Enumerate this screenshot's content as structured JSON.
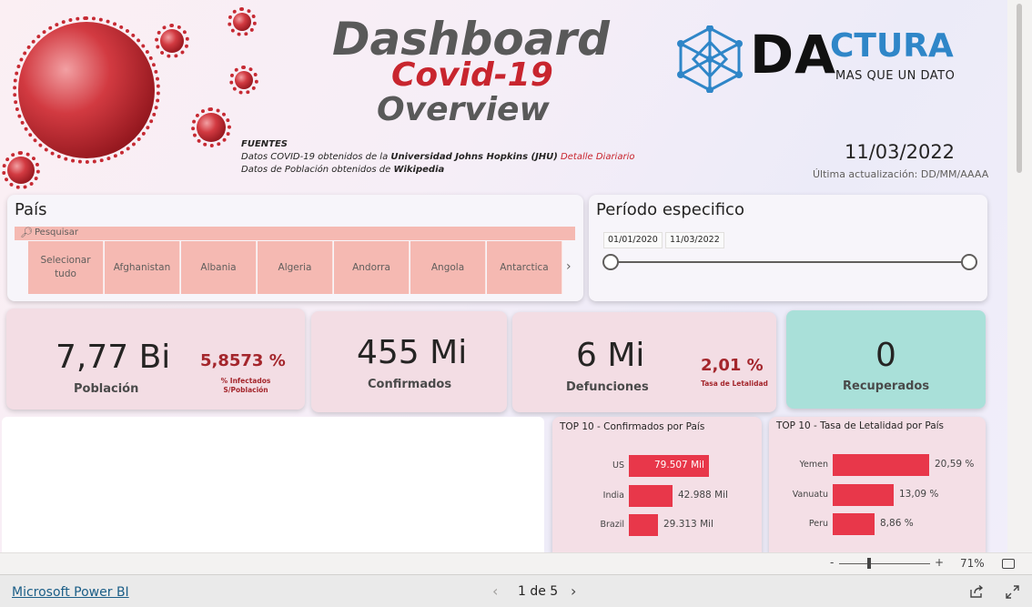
{
  "header": {
    "title_line1": "Dashboard",
    "title_line2": "Covid-19",
    "title_line3": "Overview",
    "sources_heading": "FUENTES",
    "source1_prefix": "Datos COVID-19 obtenidos de la ",
    "source1_bold": "Universidad Johns Hopkins (JHU)",
    "source1_link": "Detalle Diariario",
    "source2_prefix": "Datos de Población obtenidos de ",
    "source2_bold": "Wikipedia",
    "logo_da": "DA",
    "logo_ctura": "CTURA",
    "logo_tagline": "MAS QUE UN DATO",
    "date": "11/03/2022",
    "last_update": "Última actualización: DD/MM/AAAA"
  },
  "country_slicer": {
    "title": "País",
    "search_placeholder": "Pesquisar",
    "items": [
      "Selecionar tudo",
      "Afghanistan",
      "Albania",
      "Algeria",
      "Andorra",
      "Angola",
      "Antarctica"
    ]
  },
  "period_slicer": {
    "title": "Período especifico",
    "start": "01/01/2020",
    "end": "11/03/2022"
  },
  "kpis": {
    "population": {
      "value": "7,77 Bi",
      "label": "Población",
      "pct": "5,8573 %",
      "pct_label": "% Infectados S/Población"
    },
    "confirmed": {
      "value": "455 Mi",
      "label": "Confirmados"
    },
    "deaths": {
      "value": "6 Mi",
      "label": "Defunciones",
      "pct": "2,01 %",
      "pct_label": "Tasa de Letalidad"
    },
    "recovered": {
      "value": "0",
      "label": "Recuperados"
    }
  },
  "chart_data": [
    {
      "type": "bar",
      "title": "TOP 10 - Confirmados por País",
      "categories": [
        "US",
        "India",
        "Brazil"
      ],
      "values": [
        79507,
        42988,
        29313
      ],
      "value_labels": [
        "79.507 Mil",
        "42.988 Mil",
        "29.313 Mil"
      ]
    },
    {
      "type": "bar",
      "title": "TOP 10 - Tasa de Letalidad por País",
      "categories": [
        "Yemen",
        "Vanuatu",
        "Peru"
      ],
      "values": [
        20.59,
        13.09,
        8.86
      ],
      "value_labels": [
        "20,59 %",
        "13,09 %",
        "8,86 %"
      ]
    }
  ],
  "zoom": {
    "minus": "-",
    "plus": "+",
    "level": "71%"
  },
  "footer": {
    "powerbi_link": "Microsoft Power BI",
    "page_indicator": "1 de 5",
    "prev": "‹",
    "next": "›"
  },
  "colors": {
    "bar": "#e8374a",
    "accent_red": "#c8252e",
    "tile": "#f5b9b2",
    "kpi_green": "#a9e0d9"
  }
}
